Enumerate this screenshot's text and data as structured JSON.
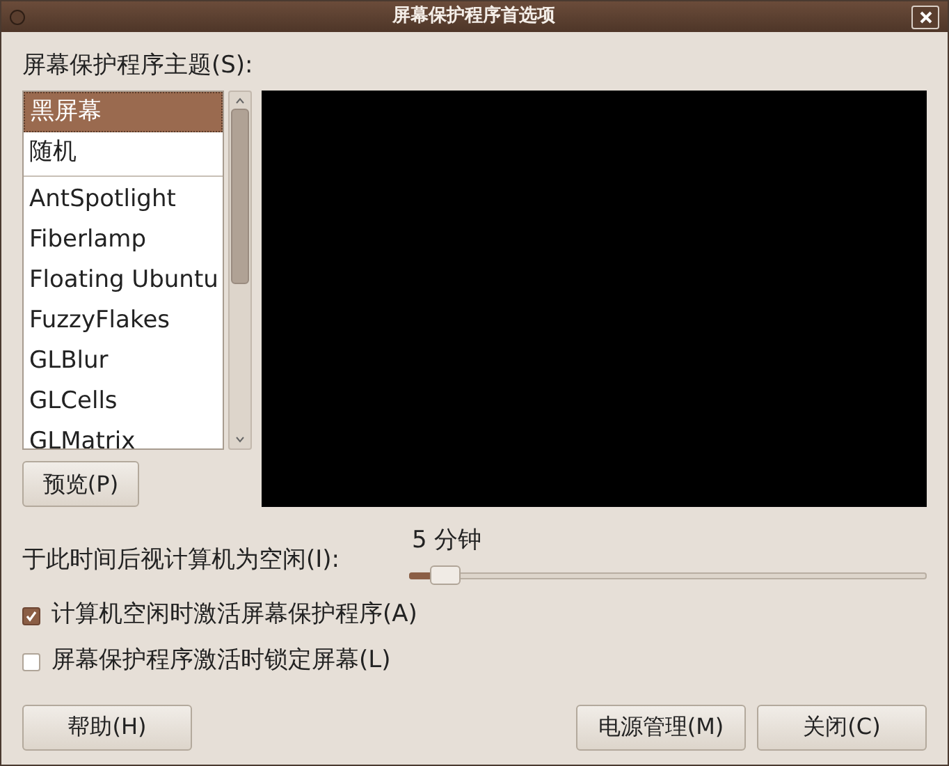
{
  "window": {
    "title": "屏幕保护程序首选项"
  },
  "theme_label": "屏幕保护程序主题(S):",
  "themes": [
    {
      "label": "黑屏幕",
      "selected": true,
      "separator_after": false
    },
    {
      "label": "随机",
      "selected": false,
      "separator_after": true
    },
    {
      "label": "AntSpotlight",
      "selected": false,
      "separator_after": false
    },
    {
      "label": "Fiberlamp",
      "selected": false,
      "separator_after": false
    },
    {
      "label": "Floating Ubuntu",
      "selected": false,
      "separator_after": false
    },
    {
      "label": "FuzzyFlakes",
      "selected": false,
      "separator_after": false
    },
    {
      "label": "GLBlur",
      "selected": false,
      "separator_after": false
    },
    {
      "label": "GLCells",
      "selected": false,
      "separator_after": false
    },
    {
      "label": "GLMatrix",
      "selected": false,
      "separator_after": false
    }
  ],
  "preview_button": "预览(P)",
  "idle": {
    "label": "于此时间后视计算机为空闲(I):",
    "value": "5 分钟",
    "level": 0.05
  },
  "checkboxes": [
    {
      "label": "计算机空闲时激活屏幕保护程序(A)",
      "checked": true
    },
    {
      "label": "屏幕保护程序激活时锁定屏幕(L)",
      "checked": false
    }
  ],
  "buttons": {
    "help": "帮助(H)",
    "power": "电源管理(M)",
    "close": "关闭(C)"
  }
}
